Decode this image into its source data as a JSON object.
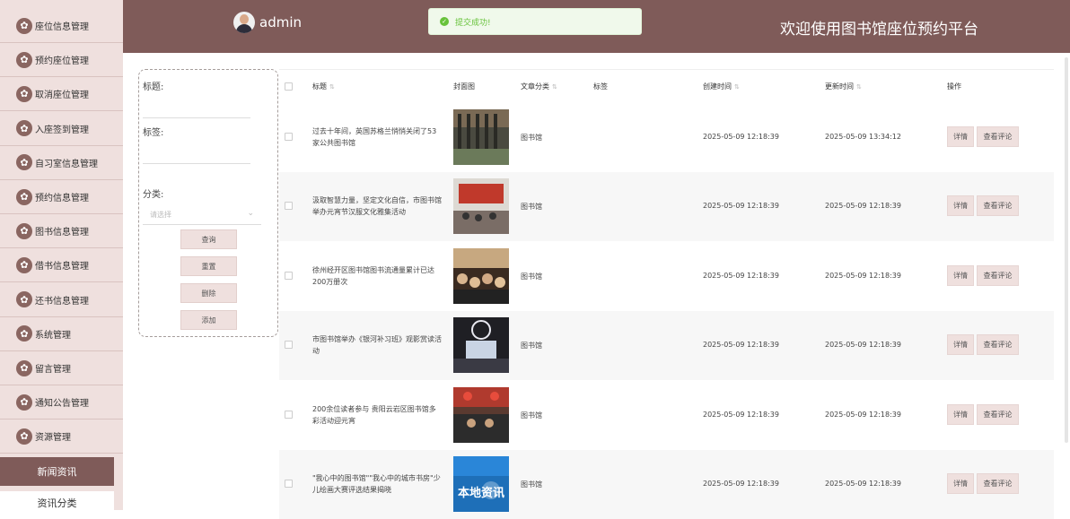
{
  "sidebar": {
    "items": [
      {
        "label": "座位信息管理"
      },
      {
        "label": "预约座位管理"
      },
      {
        "label": "取消座位管理"
      },
      {
        "label": "入座签到管理"
      },
      {
        "label": "自习室信息管理"
      },
      {
        "label": "预约信息管理"
      },
      {
        "label": "图书信息管理"
      },
      {
        "label": "借书信息管理"
      },
      {
        "label": "还书信息管理"
      },
      {
        "label": "系统管理"
      },
      {
        "label": "留言管理"
      },
      {
        "label": "通知公告管理"
      },
      {
        "label": "资源管理"
      }
    ],
    "active": "新闻资讯",
    "sub": "资讯分类",
    "icon": "flower-icon"
  },
  "header": {
    "username": "admin",
    "welcome": "欢迎使用图书馆座位预约平台",
    "toast": "提交成功!",
    "bg_color": "#7f5b59"
  },
  "search": {
    "title_label": "标题:",
    "tag_label": "标签:",
    "category_label": "分类:",
    "category_placeholder": "请选择",
    "buttons": {
      "query": "查询",
      "reset": "重置",
      "delete": "删除",
      "add": "添加"
    }
  },
  "table": {
    "headers": {
      "title": "标题",
      "cover": "封面图",
      "category": "文章分类",
      "tags": "标签",
      "created": "创建时间",
      "updated": "更新时间",
      "actions": "操作"
    },
    "rows": [
      {
        "title": "过去十年间，英国苏格兰悄悄关闭了53家公共图书馆",
        "category": "图书馆",
        "tags": "",
        "created": "2025-05-09 12:18:39",
        "updated": "2025-05-09 13:34:12",
        "thumb": "library-hall"
      },
      {
        "title": "汲取智慧力量，坚定文化自信，市图书馆举办元宵节汉服文化雅集活动",
        "category": "图书馆",
        "tags": "",
        "created": "2025-05-09 12:18:39",
        "updated": "2025-05-09 12:18:39",
        "thumb": "event-room"
      },
      {
        "title": "徐州经开区图书馆图书流通量累计已达200万册次",
        "category": "图书馆",
        "tags": "",
        "created": "2025-05-09 12:18:39",
        "updated": "2025-05-09 12:18:39",
        "thumb": "crowd"
      },
      {
        "title": "市图书馆举办《银河补习班》观影赏读活动",
        "category": "图书馆",
        "tags": "",
        "created": "2025-05-09 12:18:39",
        "updated": "2025-05-09 12:18:39",
        "thumb": "cinema"
      },
      {
        "title": "200余位读者参与 贵阳云岩区图书馆多彩活动迎元宵",
        "category": "图书馆",
        "tags": "",
        "created": "2025-05-09 12:18:39",
        "updated": "2025-05-09 12:18:39",
        "thumb": "lantern"
      },
      {
        "title": "\"我心中的图书馆\"\"我心中的城市书房\"少儿绘画大赛评选结果揭晓",
        "category": "图书馆",
        "tags": "",
        "created": "2025-05-09 12:18:39",
        "updated": "2025-05-09 12:18:39",
        "thumb": "news-logo",
        "thumb_text": "本地资讯"
      }
    ],
    "action_detail": "详情",
    "action_comments": "查看评论"
  }
}
